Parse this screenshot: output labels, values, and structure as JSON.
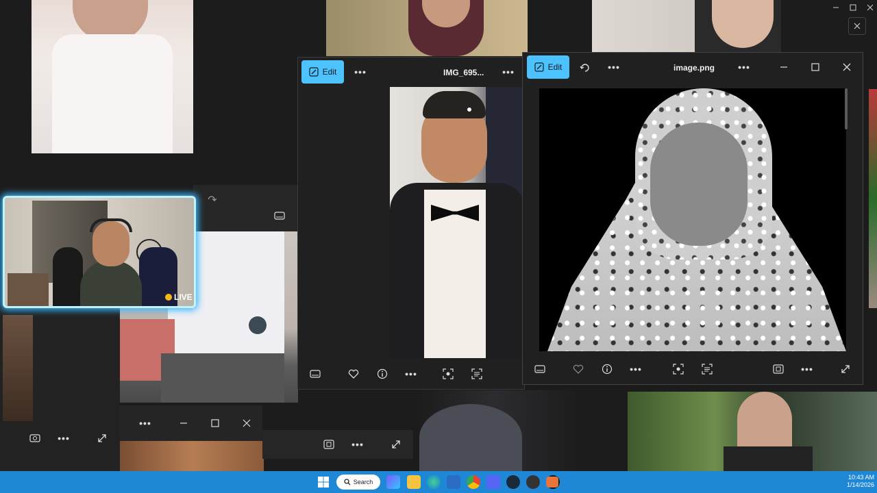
{
  "background_window": {
    "minimize_icon": "minimize-icon",
    "maximize_icon": "maximize-icon",
    "close_icon": "close-icon"
  },
  "viewer_center": {
    "edit_label": "Edit",
    "filename": "IMG_695..."
  },
  "viewer_right": {
    "edit_label": "Edit",
    "filename": "image.png"
  },
  "webcam": {
    "live_label": "LIVE"
  },
  "search": {
    "label": "Search"
  },
  "clock": {
    "time": "10:43 AM",
    "date": "1/14/2026"
  },
  "colors": {
    "accent": "#4cc2ff",
    "taskbar": "#1e88d6",
    "window_bg": "#202020"
  }
}
